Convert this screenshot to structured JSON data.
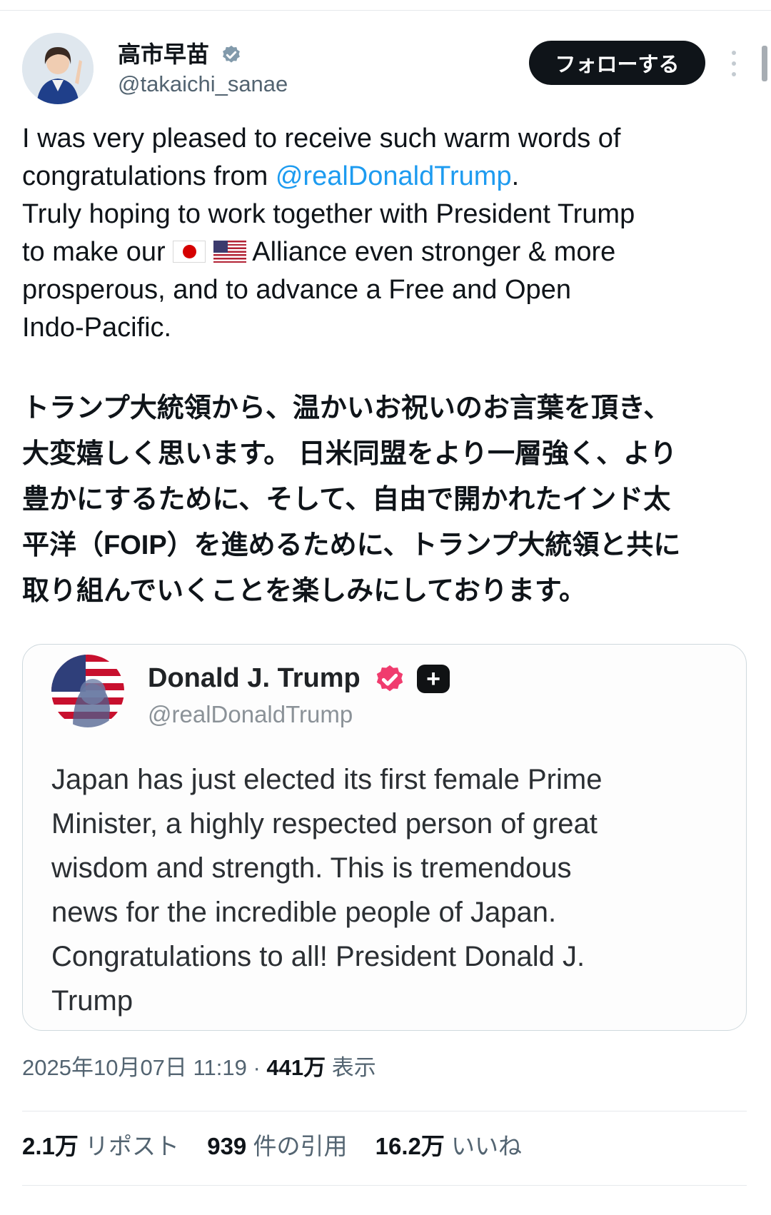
{
  "author": {
    "display_name": "高市早苗",
    "handle": "@takaichi_sanae",
    "verified": true
  },
  "follow_button": {
    "label": "フォローする"
  },
  "tweet": {
    "en_lines": [
      {
        "text": "I was very pleased to receive such warm words of"
      },
      {
        "text": "congratulations from ",
        "mention": "@realDonaldTrump",
        "after": "."
      },
      {
        "text": "Truly hoping to work together with President Trump"
      },
      {
        "before": "to make our ",
        "flags": [
          "flag-jp",
          "flag-us"
        ],
        "after": " Alliance even stronger & more"
      },
      {
        "text": "prosperous, and to advance a Free and Open"
      },
      {
        "text": "Indo-Pacific."
      }
    ],
    "ja_lines": [
      "トランプ大統領から、温かいお祝いのお言葉を頂き、",
      "大変嬉しく思います。 日米同盟をより一層強く、より",
      "豊かにするために、そして、自由で開かれたインド太",
      "平洋（FOIP）を進めるために、トランプ大統領と共に",
      "取り組んでいくことを楽しみにしております。"
    ]
  },
  "quote": {
    "display_name": "Donald J. Trump",
    "handle": "@realDonaldTrump",
    "lines": [
      "Japan has just elected its first female Prime",
      "Minister, a highly respected person of great",
      "wisdom and strength. This is tremendous",
      "news for the incredible people of Japan.",
      "Congratulations to all! President Donald J.",
      "Trump"
    ]
  },
  "meta": {
    "datetime": "2025年10月07日 11:19",
    "separator": "·",
    "views": "441万",
    "views_label": "表示"
  },
  "stats": {
    "reposts_count": "2.1万",
    "reposts_label": "リポスト",
    "quotes_count": "939",
    "quotes_label": "件の引用",
    "likes_count": "16.2万",
    "likes_label": "いいね"
  },
  "colors": {
    "link": "#1d9bf0",
    "text": "#0f1419",
    "secondary": "#536471",
    "border": "#cfd9de",
    "follow_bg": "#0f1419",
    "verified_blue": "#829aab",
    "verified_pink": "#f03c6e"
  }
}
